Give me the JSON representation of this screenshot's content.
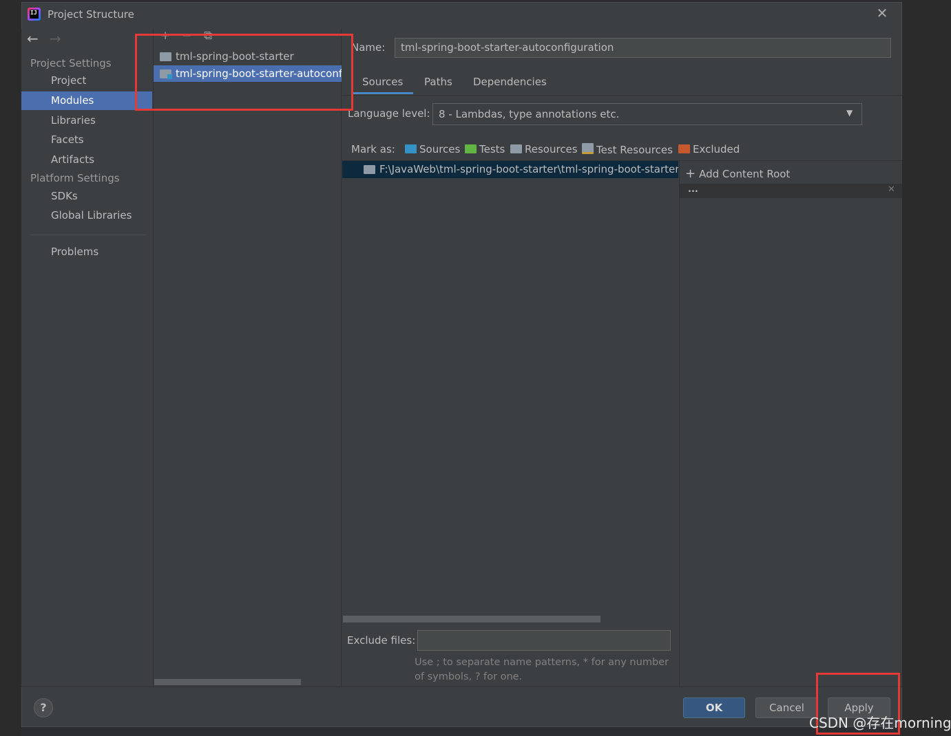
{
  "window": {
    "title": "Project Structure"
  },
  "nav": {
    "sections": [
      {
        "label": "Project Settings",
        "items": [
          "Project",
          "Modules",
          "Libraries",
          "Facets",
          "Artifacts"
        ]
      },
      {
        "label": "Platform Settings",
        "items": [
          "SDKs",
          "Global Libraries"
        ]
      }
    ],
    "problems": "Problems",
    "selected": "Modules"
  },
  "modules": {
    "toolbar": {
      "add": "+",
      "remove": "−",
      "copy": "⧉"
    },
    "items": [
      "tml-spring-boot-starter",
      "tml-spring-boot-starter-autoconfiguration"
    ],
    "selected_index": 1
  },
  "detail": {
    "name_label": "Name:",
    "name_value": "tml-spring-boot-starter-autoconfiguration",
    "tabs": [
      "Sources",
      "Paths",
      "Dependencies"
    ],
    "active_tab": "Sources",
    "language_level_label": "Language level:",
    "language_level_value": "8 - Lambdas, type annotations etc.",
    "mark_as_label": "Mark as:",
    "mark_as": [
      {
        "label": "Sources",
        "color": "#3592c4"
      },
      {
        "label": "Tests",
        "color": "#62b543"
      },
      {
        "label": "Resources",
        "color": "#8e9aa6"
      },
      {
        "label": "Test Resources",
        "color": "#8e9aa6"
      },
      {
        "label": "Excluded",
        "color": "#c65a2e"
      }
    ],
    "content_root": "F:\\JavaWeb\\tml-spring-boot-starter\\tml-spring-boot-starter-autoconfiguration",
    "add_content_root": "Add Content Root",
    "root_header_dots": "...",
    "exclude_files_label": "Exclude files:",
    "exclude_files_value": "",
    "hint": "Use ; to separate name patterns, * for any number of symbols, ? for one."
  },
  "footer": {
    "help": "?",
    "ok": "OK",
    "cancel": "Cancel",
    "apply": "Apply"
  },
  "watermark": "CSDN @存在morning",
  "colors": {
    "selection": "#4b6eaf",
    "accent": "#4a88c7",
    "annotation": "#e53935"
  }
}
